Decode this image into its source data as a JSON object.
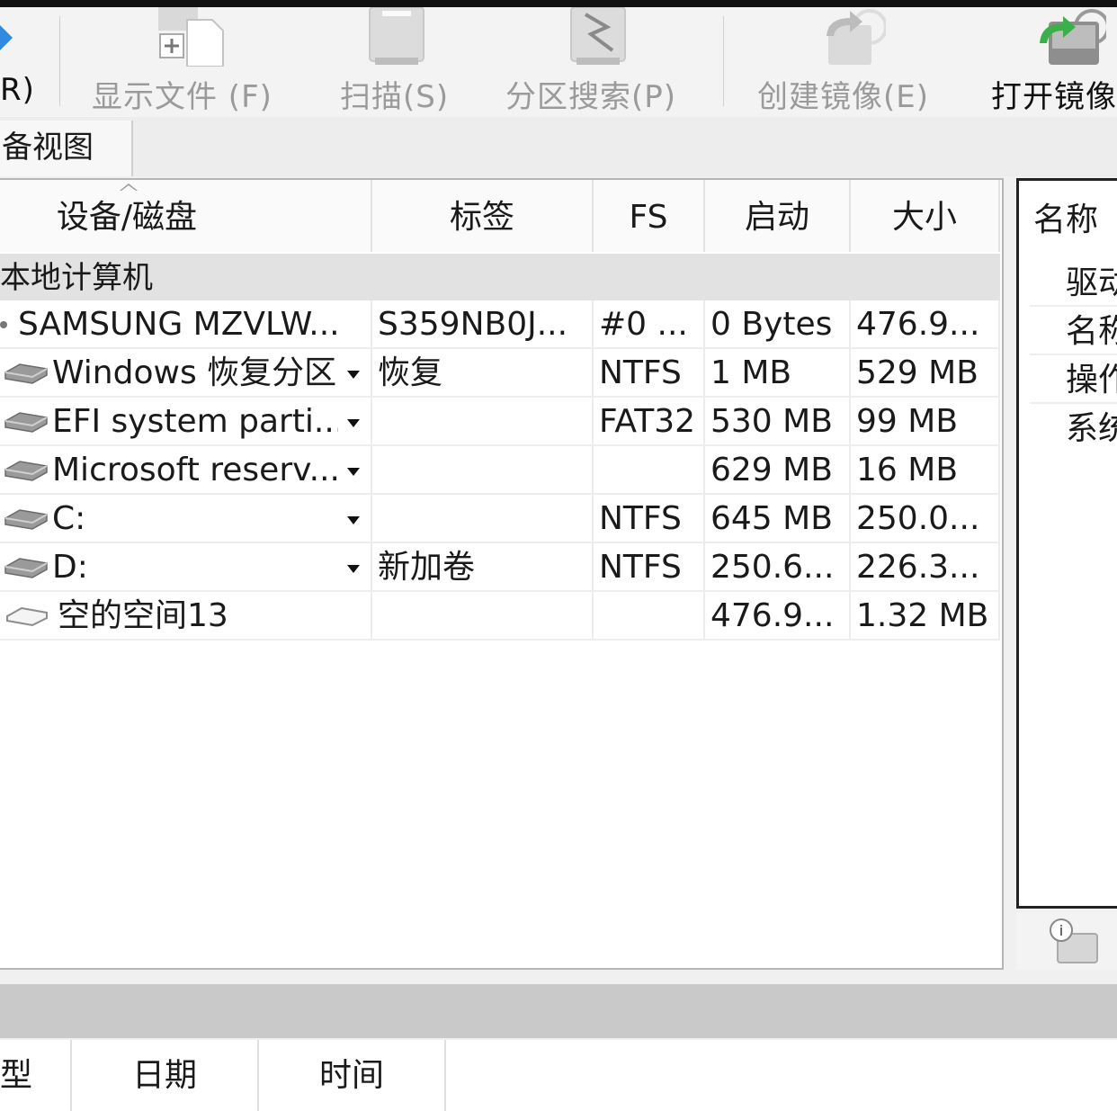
{
  "toolbar": {
    "items": [
      {
        "label": "R)",
        "icon": "partial-icon",
        "enabled": true
      },
      {
        "label": "显示文件 (F)",
        "icon": "show-files-icon",
        "enabled": false
      },
      {
        "label": "扫描(S)",
        "icon": "scan-disk-icon",
        "enabled": false
      },
      {
        "label": "分区搜索(P)",
        "icon": "partition-search-icon",
        "enabled": false
      },
      {
        "label": "创建镜像(E)",
        "icon": "create-image-icon",
        "enabled": false
      },
      {
        "label": "打开镜像",
        "icon": "open-image-icon",
        "enabled": true
      }
    ]
  },
  "view_tab": {
    "label": "备视图"
  },
  "table": {
    "columns": [
      "设备/磁盘",
      "标签",
      "FS",
      "启动",
      "大小"
    ],
    "group": "本地计算机",
    "rows": [
      {
        "device": "SAMSUNG MZVLW...",
        "label": "S359NB0J...",
        "fs": "#0 ...",
        "start": "0 Bytes",
        "size": "476.9...",
        "icon": "disk-icon",
        "dropdown": false
      },
      {
        "device": "Windows 恢复分区",
        "label": "恢复",
        "fs": "NTFS",
        "start": "1 MB",
        "size": "529 MB",
        "icon": "partition-icon",
        "dropdown": true
      },
      {
        "device": "EFI system parti...",
        "label": "",
        "fs": "FAT32",
        "start": "530 MB",
        "size": "99 MB",
        "icon": "partition-icon",
        "dropdown": true
      },
      {
        "device": "Microsoft reserv...",
        "label": "",
        "fs": "",
        "start": "629 MB",
        "size": "16 MB",
        "icon": "partition-icon",
        "dropdown": true
      },
      {
        "device": "C:",
        "label": "",
        "fs": "NTFS",
        "start": "645 MB",
        "size": "250.0...",
        "icon": "partition-icon",
        "dropdown": true
      },
      {
        "device": "D:",
        "label": "新加卷",
        "fs": "NTFS",
        "start": "250.6...",
        "size": "226.3...",
        "icon": "partition-icon",
        "dropdown": true
      },
      {
        "device": "空的空间13",
        "label": "",
        "fs": "",
        "start": "476.9...",
        "size": "1.32 MB",
        "icon": "empty-space-icon",
        "dropdown": false
      }
    ]
  },
  "info_panel": {
    "header": "名称",
    "items": [
      "驱动",
      "名称",
      "操作",
      "系统"
    ],
    "footer_icon": "info-icon"
  },
  "bottom_columns": [
    "型",
    "日期",
    "时间"
  ]
}
